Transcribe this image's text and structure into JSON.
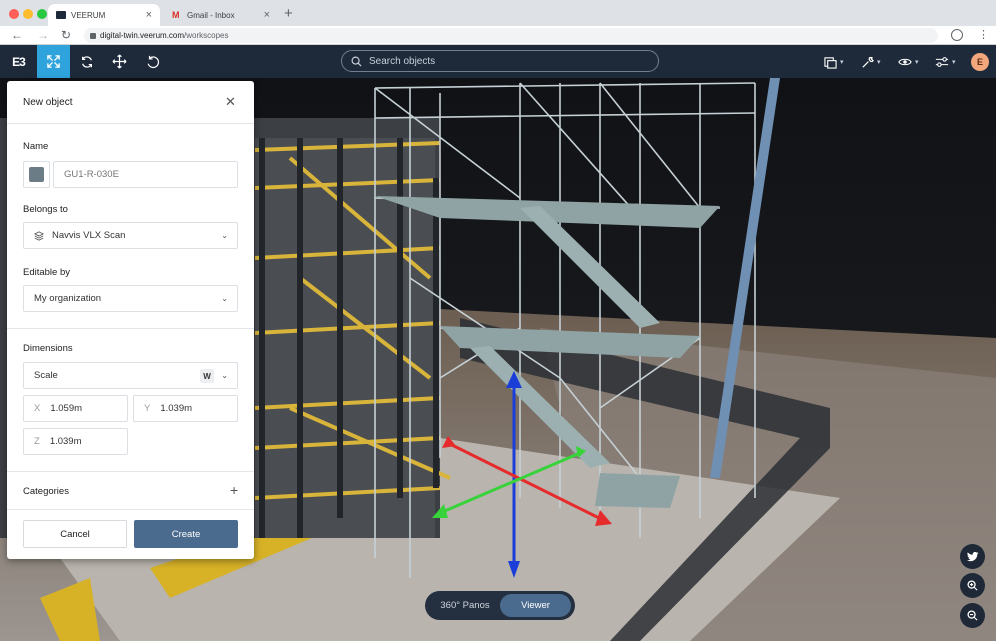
{
  "browser": {
    "tabs": [
      {
        "label": "VEERUM",
        "active": true
      },
      {
        "label": "Gmail - Inbox",
        "active": false
      }
    ],
    "url_host": "digital-twin.veerum.com",
    "url_path": "/workscopes"
  },
  "toolbar": {
    "logo": "E3",
    "tools": [
      "expand-tool",
      "sync-tool",
      "move-tool",
      "undo-tool"
    ],
    "search_placeholder": "Search objects",
    "right_tools": [
      "layers-icon",
      "wrench-icon",
      "eye-icon",
      "sliders-icon"
    ],
    "user_initial": "E",
    "accent": "#2fa3dc",
    "bg": "#1e2a3a"
  },
  "panel": {
    "title": "New object",
    "name_label": "Name",
    "name_placeholder": "GU1-R-030E",
    "swatch_color": "#6b7c87",
    "belongs_label": "Belongs to",
    "belongs_value": "Navvis VLX Scan",
    "editable_label": "Editable by",
    "editable_value": "My organization",
    "dimensions_label": "Dimensions",
    "scale_value": "Scale",
    "scale_badge": "W",
    "x_axis": "X",
    "x_value": "1.059m",
    "y_axis": "Y",
    "y_value": "1.039m",
    "z_axis": "Z",
    "z_value": "1.039m",
    "categories_label": "Categories",
    "cancel_label": "Cancel",
    "create_label": "Create",
    "create_color": "#4a6a8e"
  },
  "view_toggle": {
    "panos_label": "360° Panos",
    "viewer_label": "Viewer",
    "active": "Viewer"
  },
  "floating_buttons": [
    "twitter-icon",
    "zoom-in-icon",
    "zoom-out-icon"
  ]
}
